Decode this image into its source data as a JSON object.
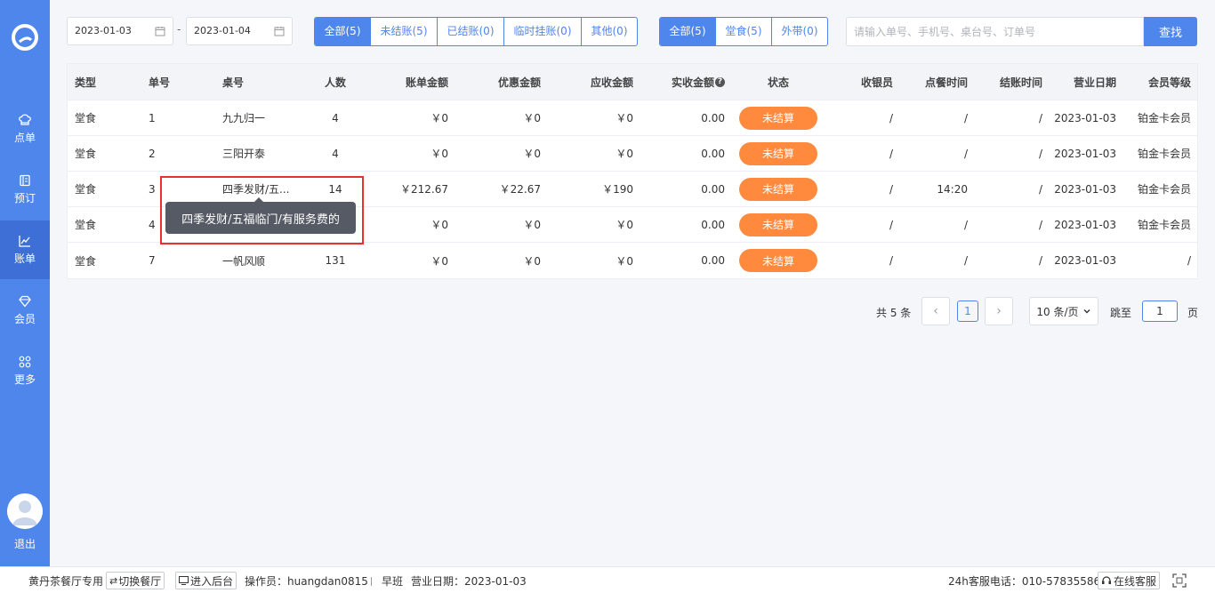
{
  "colors": {
    "primary": "#4f86ec",
    "status_unsettled": "#ff8a3d",
    "highlight": "#e8332a"
  },
  "sidebar": {
    "items": [
      {
        "label": "点单",
        "icon": "chef-hat-icon"
      },
      {
        "label": "预订",
        "icon": "book-icon"
      },
      {
        "label": "账单",
        "icon": "chart-icon",
        "active": true
      },
      {
        "label": "会员",
        "icon": "diamond-icon"
      },
      {
        "label": "更多",
        "icon": "grid-icon"
      }
    ],
    "logout_label": "退出"
  },
  "filters": {
    "date_start": "2023-01-03",
    "date_sep": "-",
    "date_end": "2023-01-04",
    "status_tabs": [
      "全部(5)",
      "未结账(5)",
      "已结账(0)",
      "临时挂账(0)",
      "其他(0)"
    ],
    "type_tabs": [
      "全部(5)",
      "堂食(5)",
      "外带(0)"
    ],
    "search_placeholder": "请输入单号、手机号、桌台号、订单号",
    "search_button": "查找"
  },
  "table": {
    "headers": [
      "类型",
      "单号",
      "桌号",
      "人数",
      "账单金额",
      "优惠金额",
      "应收金额",
      "实收金额",
      "状态",
      "收银员",
      "点餐时间",
      "结账时间",
      "营业日期",
      "会员等级"
    ],
    "help_icon": "?",
    "rows": [
      [
        "堂食",
        "1",
        "九九归一",
        "4",
        "￥0",
        "￥0",
        "￥0",
        "0.00",
        "未结算",
        "/",
        "/",
        "/",
        "2023-01-03",
        "铂金卡会员"
      ],
      [
        "堂食",
        "2",
        "三阳开泰",
        "4",
        "￥0",
        "￥0",
        "￥0",
        "0.00",
        "未结算",
        "/",
        "/",
        "/",
        "2023-01-03",
        "铂金卡会员"
      ],
      [
        "堂食",
        "3",
        "四季发财/五...",
        "14",
        "￥212.67",
        "￥22.67",
        "￥190",
        "0.00",
        "未结算",
        "/",
        "14:20",
        "/",
        "2023-01-03",
        "铂金卡会员"
      ],
      [
        "堂食",
        "4",
        "",
        "",
        "￥0",
        "￥0",
        "￥0",
        "0.00",
        "未结算",
        "/",
        "/",
        "/",
        "2023-01-03",
        "铂金卡会员"
      ],
      [
        "堂食",
        "7",
        "一帆风顺",
        "131",
        "￥0",
        "￥0",
        "￥0",
        "0.00",
        "未结算",
        "/",
        "/",
        "/",
        "2023-01-03",
        "/"
      ]
    ]
  },
  "tooltip": "四季发财/五福临门/有服务费的",
  "pagination": {
    "total": "共 5 条",
    "prev": "‹",
    "current": "1",
    "next": "›",
    "page_size": "10 条/页",
    "jump_label": "跳至",
    "jump_value": "1",
    "jump_unit": "页"
  },
  "footer": {
    "restaurant": "黄丹茶餐厅专用",
    "switch_label": "切换餐厅",
    "backend_label": "进入后台",
    "operator": "操作员：huangdan0815",
    "shift": "早班",
    "business_date": "营业日期：2023-01-03",
    "hotline": "24h客服电话：010-57835586",
    "online_service": "在线客服"
  }
}
